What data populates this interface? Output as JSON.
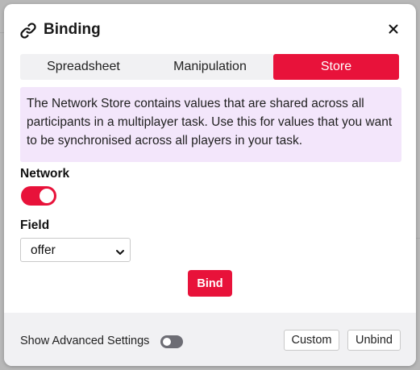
{
  "dialog": {
    "title": "Binding",
    "title_icon": "link-icon",
    "close_icon": "close-icon"
  },
  "tabs": [
    {
      "label": "Spreadsheet",
      "active": false
    },
    {
      "label": "Manipulation",
      "active": false
    },
    {
      "label": "Store",
      "active": true
    }
  ],
  "info_text": "The Network Store contains values that are shared across all participants in a multiplayer task. Use this for values that you want to be synchronised across all players in your task.",
  "network": {
    "label": "Network",
    "enabled": true
  },
  "field": {
    "label": "Field",
    "selected": "offer"
  },
  "bind_label": "Bind",
  "footer": {
    "advanced_label": "Show Advanced Settings",
    "advanced_enabled": false,
    "custom_label": "Custom",
    "unbind_label": "Unbind"
  },
  "colors": {
    "accent": "#e8123a",
    "info_bg": "#f3e6fb",
    "footer_bg": "#f1f1f3"
  }
}
